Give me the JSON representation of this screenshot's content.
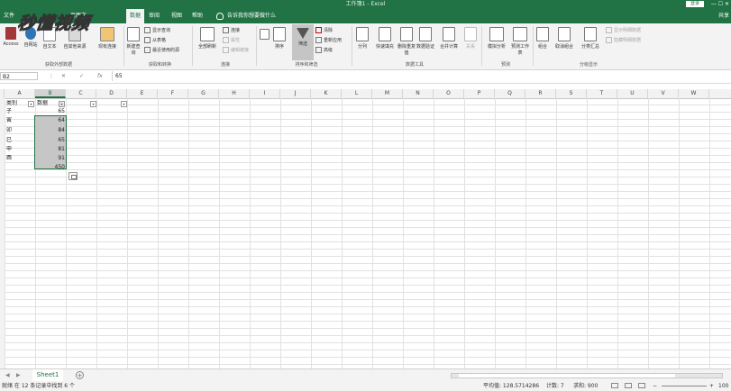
{
  "app": {
    "title": "工作簿1 - Excel",
    "login": "登录",
    "share": "共享"
  },
  "tabs": [
    {
      "label": "文件",
      "active": false
    },
    {
      "label": "页面布",
      "active": false
    },
    {
      "label": "数据",
      "active": true
    },
    {
      "label": "审阅",
      "active": false
    },
    {
      "label": "视图",
      "active": false
    },
    {
      "label": "帮助",
      "active": false
    }
  ],
  "tell_me": "告诉我你想要做什么",
  "watermark": "秒懂视频",
  "ribbon": {
    "get_external": {
      "group_label": "获取外部数据",
      "buttons": [
        "Access",
        "自网站",
        "自文本",
        "自其他来源",
        "现有连接"
      ]
    },
    "get_transform": {
      "group_label": "获取和转换",
      "new_query": "新建查询",
      "small": [
        "显示查询",
        "从表格",
        "最近使用的源"
      ]
    },
    "connections": {
      "group_label": "连接",
      "refresh_all": "全部刷新",
      "small": [
        "连接",
        "属性",
        "编辑链接"
      ]
    },
    "sort_filter": {
      "group_label": "排序和筛选",
      "sort": "排序",
      "filter": "筛选",
      "small": [
        "清除",
        "重新应用",
        "高级"
      ]
    },
    "data_tools": {
      "group_label": "数据工具",
      "buttons": [
        "分列",
        "快速填充",
        "删除重复值",
        "数据验证",
        "合并计算",
        "关系"
      ]
    },
    "forecast": {
      "group_label": "预测",
      "buttons": [
        "模拟分析",
        "预测工作表"
      ]
    },
    "outline": {
      "group_label": "分级显示",
      "buttons": [
        "组合",
        "取消组合",
        "分类汇总"
      ],
      "small": [
        "显示明细数据",
        "隐藏明细数据"
      ]
    }
  },
  "formula_bar": {
    "name_box": "B2",
    "fx": "fx",
    "content": "65"
  },
  "columns": [
    "A",
    "B",
    "C",
    "D",
    "E",
    "F",
    "G",
    "H",
    "I",
    "J",
    "K",
    "L",
    "M",
    "N",
    "O",
    "P",
    "Q",
    "R",
    "S",
    "T",
    "U",
    "V",
    "W"
  ],
  "headers": {
    "a": "类别",
    "b": "数据"
  },
  "rows": [
    {
      "cat": "子",
      "val": "65"
    },
    {
      "cat": "寅",
      "val": "64"
    },
    {
      "cat": "卯",
      "val": "84"
    },
    {
      "cat": "巳",
      "val": "65"
    },
    {
      "cat": "申",
      "val": "81"
    },
    {
      "cat": "酉",
      "val": "91"
    }
  ],
  "sum_cell": "450",
  "sheet_tab": "Sheet1",
  "status": {
    "left": "就绪  在 12 条记录中找到 6 个",
    "average": "平均值: 128.5714286",
    "count": "计数: 7",
    "sum": "求和: 900",
    "zoom": "100"
  },
  "colors": {
    "excel_green": "#217346",
    "selection": "#c6c6c6"
  }
}
